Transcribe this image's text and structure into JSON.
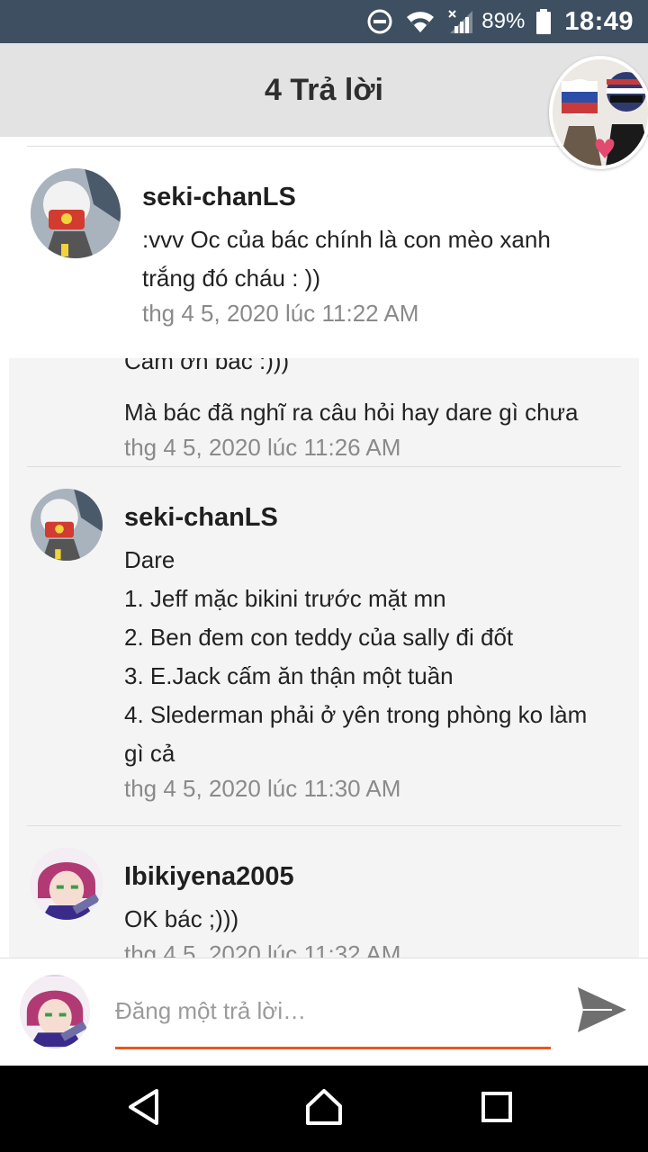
{
  "status_bar": {
    "battery": "89%",
    "time": "18:49",
    "icons": [
      "do-not-disturb-icon",
      "wifi-icon",
      "cell-signal-icon",
      "battery-icon"
    ]
  },
  "header": {
    "title": "4 Trả lời"
  },
  "comments": [
    {
      "author": "seki-chanLS",
      "lines": [
        ":vvv Oc của bác chính là con mèo xanh",
        "trắng đó cháu : ))"
      ],
      "time": "thg 4 5, 2020 lúc 11:22 AM"
    },
    {
      "author": "",
      "lines": [
        "Cảm ơn bác :)))",
        "Mà bác đã nghĩ ra câu hỏi hay dare gì chưa"
      ],
      "time": "thg 4 5, 2020 lúc 11:26 AM"
    },
    {
      "author": "seki-chanLS",
      "lines": [
        "Dare",
        "1. Jeff mặc bikini trước mặt mn",
        "2. Ben đem con teddy của sally đi đốt",
        "3. E.Jack cấm ăn thận một tuần",
        "4. Slederman phải ở yên trong phòng ko làm",
        "gì cả"
      ],
      "time": "thg 4 5, 2020 lúc 11:30 AM"
    },
    {
      "author": "Ibikiyena2005",
      "lines": [
        "OK bác ;)))"
      ],
      "time": "thg 4 5, 2020 lúc 11:32 AM"
    }
  ],
  "reply": {
    "placeholder": "Đăng một trả lời…"
  },
  "colors": {
    "status_bar": "#3d4f61",
    "header": "#e3e3e3",
    "accent_underline": "#e8571f",
    "timestamp": "#8a8a8a"
  }
}
